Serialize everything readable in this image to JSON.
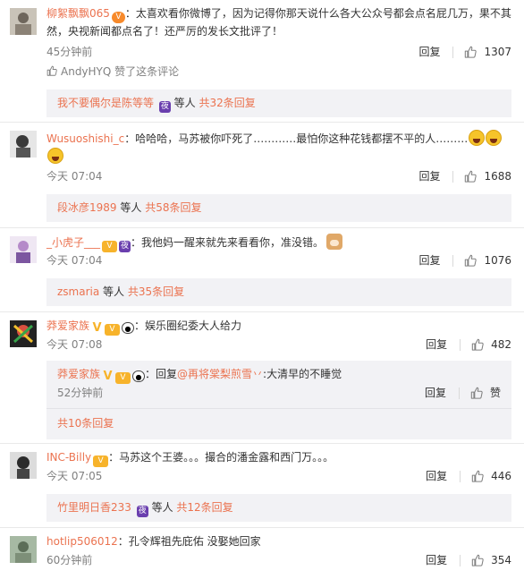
{
  "comments": [
    {
      "user": "柳絮飘飘065",
      "text_line1": "：太喜欢看你微博了，因为记得你那天说什么各大公众号都会点名屁几万，果不其",
      "text_line2": "然，央视新闻都点名了！还严厉的发长文批评了！",
      "time": "45分钟前",
      "reply_label": "回复",
      "likes": "1307",
      "liked_by": "AndyHYQ 赞了这条评论",
      "sub_users": "我不要偶尔是陈等等",
      "sub_mid": "等人",
      "sub_total": "共32条回复"
    },
    {
      "user": "Wusuoshishi_c",
      "text_line1": "：哈哈哈，马苏被你吓死了…………最怕你这种花钱都摆不平的人………",
      "time": "今天 07:04",
      "reply_label": "回复",
      "likes": "1688",
      "sub_users": "段冰彦1989",
      "sub_mid": "等人",
      "sub_total": "共58条回复"
    },
    {
      "user": "_小虎子___",
      "text_line1": "：我他妈一醒来就先来看看你，准没错。",
      "time": "今天 07:04",
      "reply_label": "回复",
      "likes": "1076",
      "sub_users": "zsmaria",
      "sub_mid": "等人",
      "sub_total": "共35条回复"
    },
    {
      "user": "莽爱家族",
      "text_line1": "：娱乐圈纪委大人给力",
      "time": "今天 07:08",
      "reply_label": "回复",
      "likes": "482",
      "nested": {
        "user": "莽爱家族",
        "pre": "：回复",
        "mention": "@再将棠梨煎雪丷",
        "text": ":大清早的不睡觉",
        "time": "52分钟前",
        "reply_label": "回复",
        "like_label": "赞"
      },
      "sub_total": "共10条回复"
    },
    {
      "user": "INC-Billy",
      "text_line1": "：马苏这个王婆。。。撮合的潘金露和西门万。。。",
      "time": "今天 07:05",
      "reply_label": "回复",
      "likes": "446",
      "sub_users": "竹里明日香233",
      "sub_mid": "等人",
      "sub_total": "共12条回复"
    },
    {
      "user": "hotlip506012",
      "text_line1": "：孔令辉祖先庇佑 没娶她回家",
      "time": "60分钟前",
      "reply_label": "回复",
      "likes": "354"
    }
  ],
  "colors": {
    "link": "#eb7350",
    "meta": "#808080",
    "reply_bg": "#f2f2f5"
  }
}
